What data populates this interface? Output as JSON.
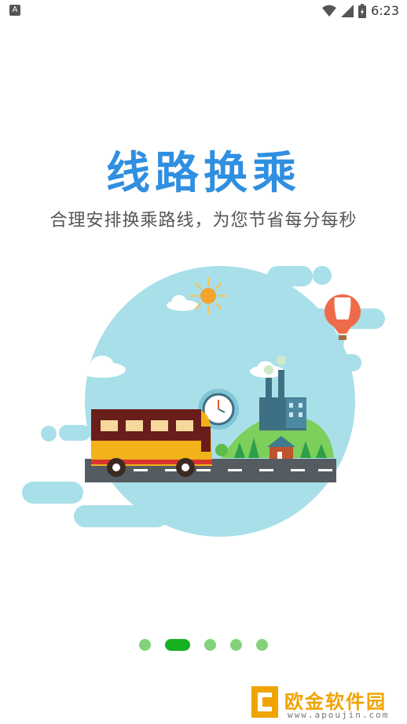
{
  "status_bar": {
    "time": "6:23",
    "left_badge": "A"
  },
  "intro": {
    "title": "线路换乘",
    "subtitle": "合理安排换乘路线，为您节省每分每秒"
  },
  "pager": {
    "page_count": 5,
    "active_index": 1
  },
  "watermark": {
    "name": "欧金软件园",
    "url": "www.apoujin.com"
  },
  "colors": {
    "title": "#2f8fe0",
    "dot_active": "#16b020",
    "dot_inactive": "#82d27a",
    "sky": "#a9dfe9",
    "watermark": "#f0a400"
  },
  "icons": [
    "notification-icon",
    "wifi-icon",
    "signal-icon",
    "battery-icon"
  ]
}
